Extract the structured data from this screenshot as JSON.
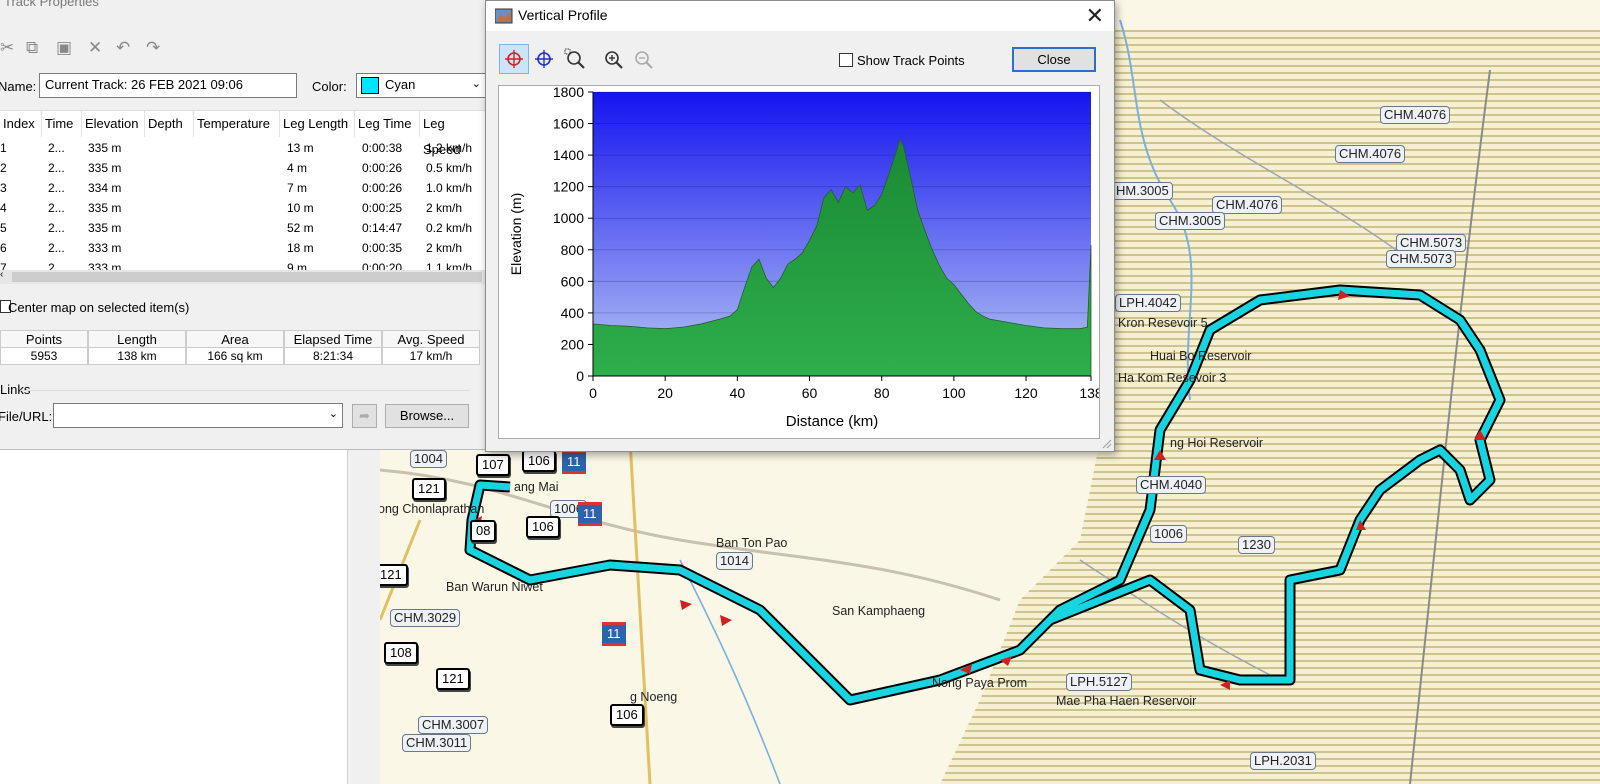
{
  "track_properties": {
    "title": "Track Properties",
    "name_label": "Name:",
    "name_value": "Current Track: 26 FEB 2021 09:06",
    "color_label": "Color:",
    "color_value": "Cyan",
    "color_swatch": "#00e5ff",
    "table": {
      "columns": [
        "Index",
        "Time",
        "Elevation",
        "Depth",
        "Temperature",
        "Leg Length",
        "Leg Time",
        "Leg Speed"
      ],
      "rows": [
        [
          "1",
          "2...",
          "335 m",
          "",
          "",
          "13 m",
          "0:00:38",
          "1.2 km/h"
        ],
        [
          "2",
          "2...",
          "335 m",
          "",
          "",
          "4 m",
          "0:00:26",
          "0.5 km/h"
        ],
        [
          "3",
          "2...",
          "334 m",
          "",
          "",
          "7 m",
          "0:00:26",
          "1.0 km/h"
        ],
        [
          "4",
          "2...",
          "335 m",
          "",
          "",
          "10 m",
          "0:00:25",
          "2 km/h"
        ],
        [
          "5",
          "2...",
          "335 m",
          "",
          "",
          "52 m",
          "0:14:47",
          "0.2 km/h"
        ],
        [
          "6",
          "2...",
          "333 m",
          "",
          "",
          "18 m",
          "0:00:35",
          "2 km/h"
        ],
        [
          "7",
          "2...",
          "333 m",
          "",
          "",
          "9 m",
          "0:00:20",
          "1.1 km/h"
        ]
      ]
    },
    "center_map_label": "Center map on selected item(s)",
    "stats": {
      "headers": [
        "Points",
        "Length",
        "Area",
        "Elapsed Time",
        "Avg. Speed"
      ],
      "values": [
        "5953",
        "138 km",
        "166 sq km",
        "8:21:34",
        "17 km/h"
      ]
    },
    "links_label": "Links",
    "file_url_label": "File/URL:",
    "browse_label": "Browse..."
  },
  "vertical_profile": {
    "title": "Vertical Profile",
    "show_track_points_label": "Show Track Points",
    "show_track_points_checked": false,
    "close_label": "Close",
    "tools": [
      "select-icon",
      "crosshair-icon",
      "zoom-area-icon",
      "zoom-in-icon",
      "zoom-out-icon"
    ]
  },
  "chart_data": {
    "type": "area",
    "xlabel": "Distance  (km)",
    "ylabel": "Elevation (m)",
    "xlim": [
      0,
      138
    ],
    "ylim": [
      0,
      1800
    ],
    "x_ticks": [
      0,
      20,
      40,
      60,
      80,
      100,
      120,
      138
    ],
    "y_ticks": [
      0,
      200,
      400,
      600,
      800,
      1000,
      1200,
      1400,
      1600,
      1800
    ],
    "grid": true,
    "fill_color": "#1e9a3c",
    "series": [
      {
        "x": [
          0,
          5,
          10,
          15,
          20,
          25,
          30,
          35,
          38,
          40,
          42,
          44,
          46,
          48,
          50,
          52,
          54,
          56,
          58,
          60,
          62,
          64,
          66,
          68,
          70,
          72,
          74,
          76,
          78,
          80,
          82,
          84,
          85,
          86,
          87,
          88,
          90,
          92,
          94,
          96,
          98,
          100,
          102,
          104,
          106,
          108,
          110,
          115,
          120,
          125,
          130,
          135,
          137,
          138
        ],
        "y": [
          330,
          320,
          315,
          305,
          300,
          310,
          330,
          360,
          380,
          420,
          560,
          690,
          740,
          620,
          560,
          620,
          710,
          740,
          780,
          860,
          950,
          1130,
          1180,
          1100,
          1200,
          1160,
          1210,
          1050,
          1080,
          1150,
          1280,
          1420,
          1500,
          1460,
          1360,
          1260,
          1050,
          920,
          800,
          700,
          620,
          580,
          520,
          460,
          410,
          380,
          360,
          340,
          320,
          305,
          300,
          300,
          310,
          830
        ]
      }
    ]
  },
  "map": {
    "route_color": "#18d4e0",
    "road_labels": [
      {
        "text": "CHM.4076"
      },
      {
        "text": "CHM.4076"
      },
      {
        "text": "HM.3005"
      },
      {
        "text": "CHM.4076"
      },
      {
        "text": "CHM.3005"
      },
      {
        "text": "CHM.5073"
      },
      {
        "text": "CHM.5073"
      },
      {
        "text": "LPH.4042"
      },
      {
        "text": "CHM.4040"
      },
      {
        "text": "1006"
      },
      {
        "text": "1230"
      },
      {
        "text": "CHM.3029"
      },
      {
        "text": "LPH.5127"
      },
      {
        "text": "CHM.3007"
      },
      {
        "text": "CHM.3011"
      },
      {
        "text": "LPH.2031"
      },
      {
        "text": "1014"
      },
      {
        "text": "1006"
      },
      {
        "text": "1004"
      }
    ],
    "shields": [
      {
        "text": "107"
      },
      {
        "text": "106"
      },
      {
        "text": "121"
      },
      {
        "text": "106"
      },
      {
        "text": "121"
      },
      {
        "text": "108"
      },
      {
        "text": "121"
      },
      {
        "text": "106"
      },
      {
        "text": "08"
      }
    ],
    "blue_shields": [
      {
        "text": "11"
      },
      {
        "text": "11"
      },
      {
        "text": "11"
      }
    ],
    "places": [
      {
        "text": "Kron Resevoir 5"
      },
      {
        "text": "Huai Bo Reservoir"
      },
      {
        "text": "Ha Kom Resevoir 3"
      },
      {
        "text": "ng Hoi Reservoir"
      },
      {
        "text": "Ban Ton Pao"
      },
      {
        "text": "San Kamphaeng"
      },
      {
        "text": "Nong Paya Prom"
      },
      {
        "text": "Mae Pha Haen Reservoir"
      },
      {
        "text": "Ban Warun Niwet"
      },
      {
        "text": "ang Mai"
      },
      {
        "text": "ong Chonlaprathan"
      },
      {
        "text": "g Noeng"
      }
    ]
  }
}
